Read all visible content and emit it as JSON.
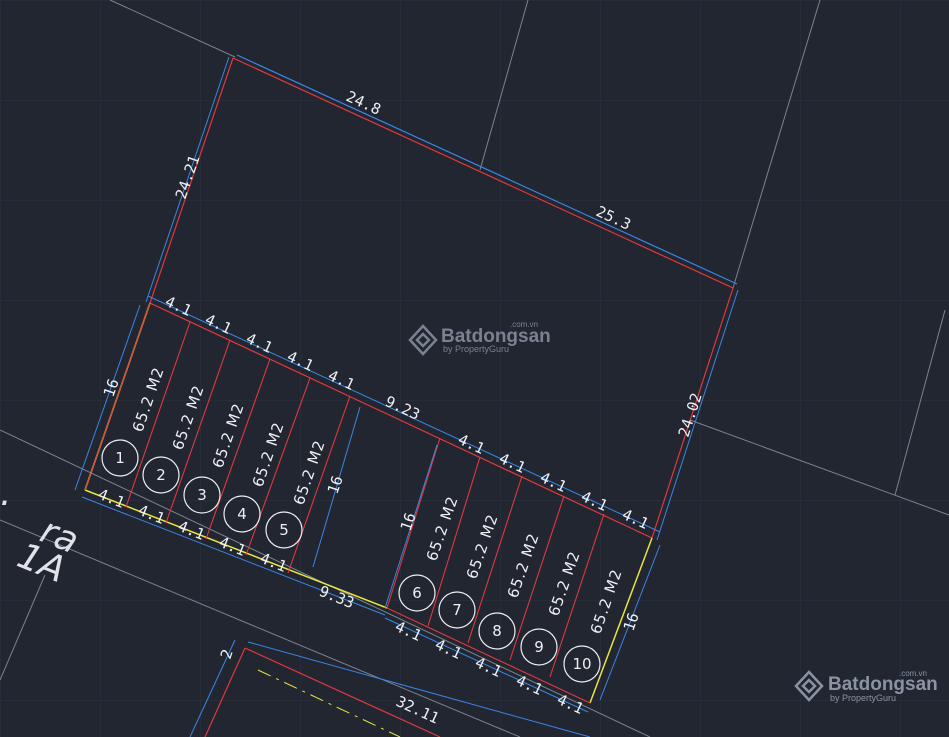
{
  "drawing": {
    "boundary_dims": {
      "top_left": "24.8",
      "top_right": "25.3",
      "left": "24.21",
      "right": "24.02"
    },
    "front_dims_a": [
      "4.1",
      "4.1",
      "4.1",
      "4.1",
      "4.1"
    ],
    "front_gap_a": "9.23",
    "front_dims_b": [
      "4.1",
      "4.1",
      "4.1",
      "4.1",
      "4.1"
    ],
    "depth_dims": {
      "group_a_left": "16",
      "group_a_mid": "16",
      "group_b_left": "16",
      "group_b_right": "16"
    },
    "back_dims_a": [
      "4.1",
      "4.1",
      "4.1",
      "4.1",
      "4.1"
    ],
    "back_gap": "9.33",
    "back_dims_b": [
      "4.1",
      "4.1",
      "4.1",
      "4.1",
      "4.1"
    ],
    "road_dim": "32.11",
    "road_side_dim": "2",
    "lots": [
      {
        "number": "1",
        "area": "65.2 M2"
      },
      {
        "number": "2",
        "area": "65.2 M2"
      },
      {
        "number": "3",
        "area": "65.2 M2"
      },
      {
        "number": "4",
        "area": "65.2 M2"
      },
      {
        "number": "5",
        "area": "65.2 M2"
      },
      {
        "number": "6",
        "area": "65.2 M2"
      },
      {
        "number": "7",
        "area": "65.2 M2"
      },
      {
        "number": "8",
        "area": "65.2 M2"
      },
      {
        "number": "9",
        "area": "65.2 M2"
      },
      {
        "number": "10",
        "area": "65.2 M2"
      }
    ],
    "road_text_1": "ra",
    "road_text_2": "1A"
  },
  "watermark": {
    "brand": "Batdongsan",
    "domain": ".com.vn",
    "sub": "by PropertyGuru"
  },
  "colors": {
    "background": "#212630",
    "grid": "#2d3440",
    "dimension": "#3a86e6",
    "lot_line": "#e0383e",
    "frontage": "#e6e640",
    "road_line": "#7d838e",
    "text": "#eef0f3"
  }
}
